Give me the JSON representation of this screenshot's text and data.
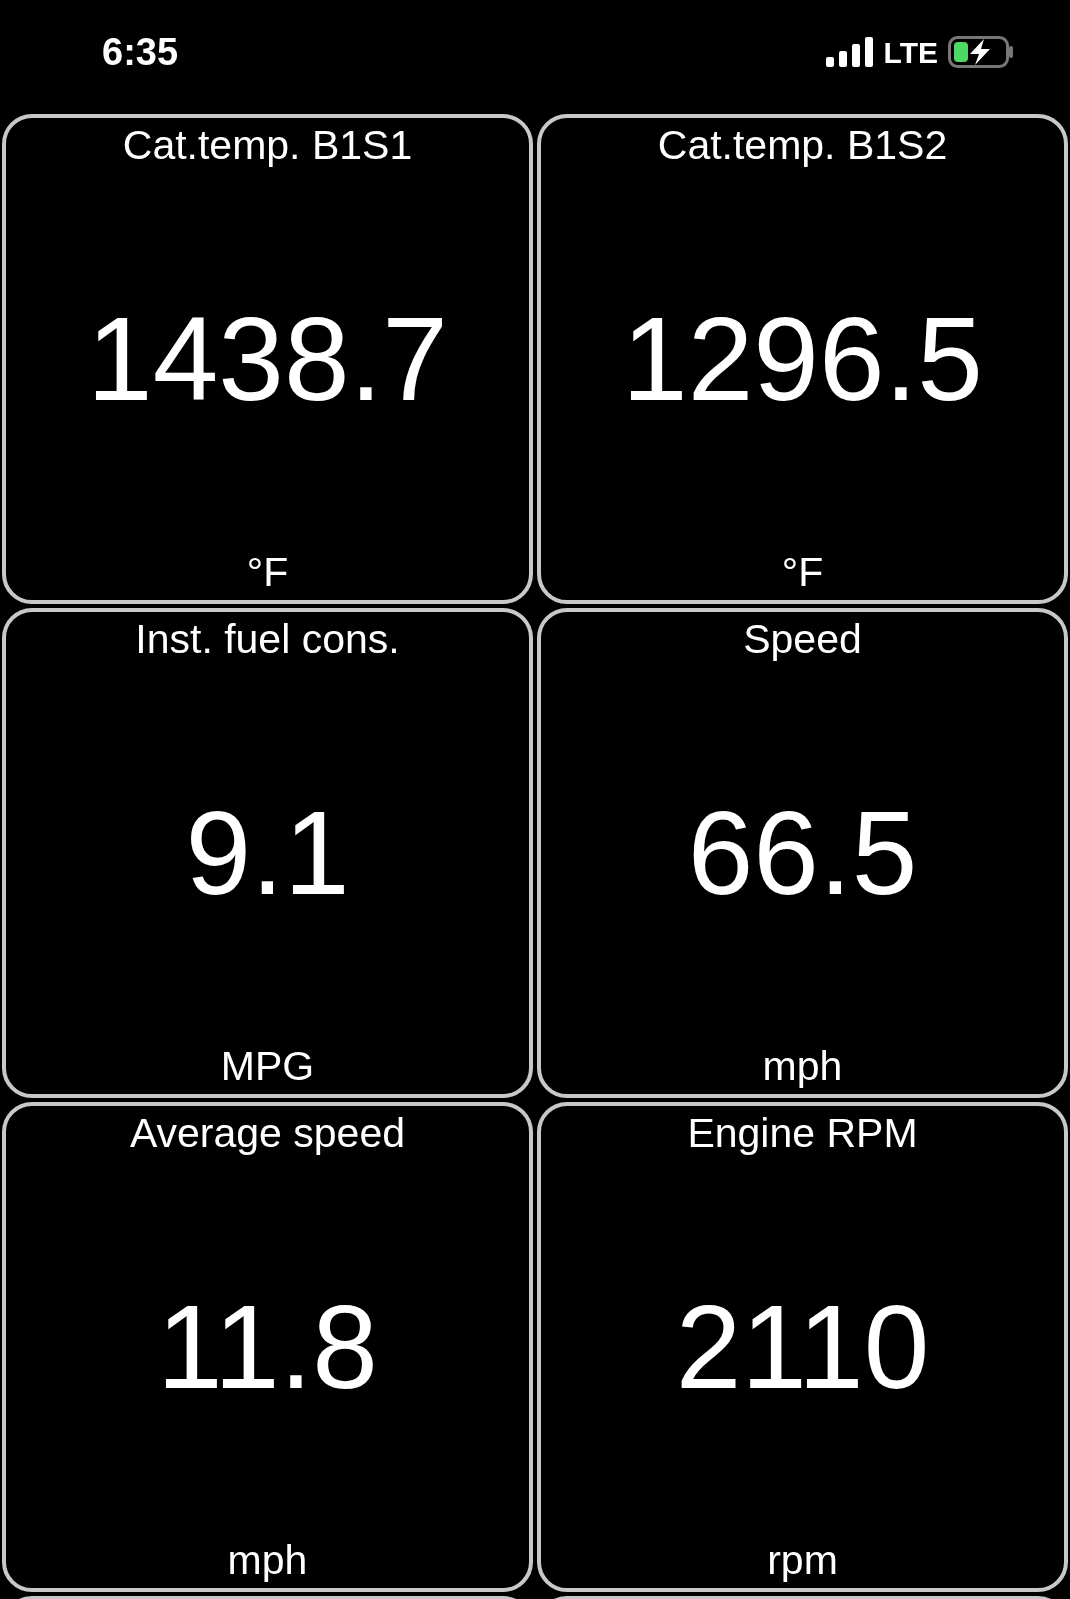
{
  "status_bar": {
    "time": "6:35",
    "network": "LTE"
  },
  "tiles": [
    {
      "title": "Cat.temp. B1S1",
      "value": "1438.7",
      "unit": "°F"
    },
    {
      "title": "Cat.temp. B1S2",
      "value": "1296.5",
      "unit": "°F"
    },
    {
      "title": "Inst. fuel cons.",
      "value": "9.1",
      "unit": "MPG"
    },
    {
      "title": "Speed",
      "value": "66.5",
      "unit": "mph"
    },
    {
      "title": "Average speed",
      "value": "11.8",
      "unit": "mph"
    },
    {
      "title": "Engine RPM",
      "value": "2110",
      "unit": "rpm"
    }
  ]
}
